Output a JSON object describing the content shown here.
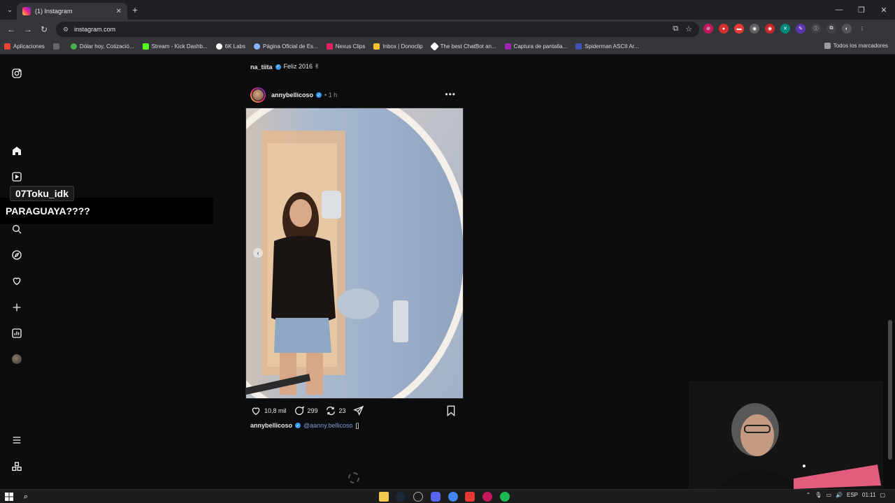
{
  "browser": {
    "tab_title": "(1) Instagram",
    "url": "instagram.com",
    "bookmarks": [
      "Aplicaciones",
      "Dólar hoy, Cotizació...",
      "Stream - Kick Dashb...",
      "6K Labs",
      "Página Oficial de Es...",
      "Nexus Clips",
      "Inbox | Donoclip",
      "The best ChatBot an...",
      "Captura de pantalla...",
      "Spiderman ASCII Ar..."
    ],
    "all_bookmarks": "Todos los marcadores"
  },
  "overlay": {
    "username": "07Toku_idk",
    "message": "PARAGUAYA????"
  },
  "feed": {
    "previous_post": {
      "username": "na_tiita",
      "caption": "Feliz 2016 ✌"
    },
    "post": {
      "username": "annybellicoso",
      "time": "1 h",
      "likes": "10,8 mil",
      "comments": "299",
      "reposts": "23",
      "caption_user": "annybellicoso",
      "caption_mention": "@aanny.bellicoso",
      "caption_tail": "[]"
    }
  },
  "taskbar": {
    "language": "ESP",
    "time": "01:11"
  },
  "colors": {
    "verified": "#3797f0",
    "page_bg": "#0b0c0e",
    "chrome_bg": "#35363a"
  }
}
